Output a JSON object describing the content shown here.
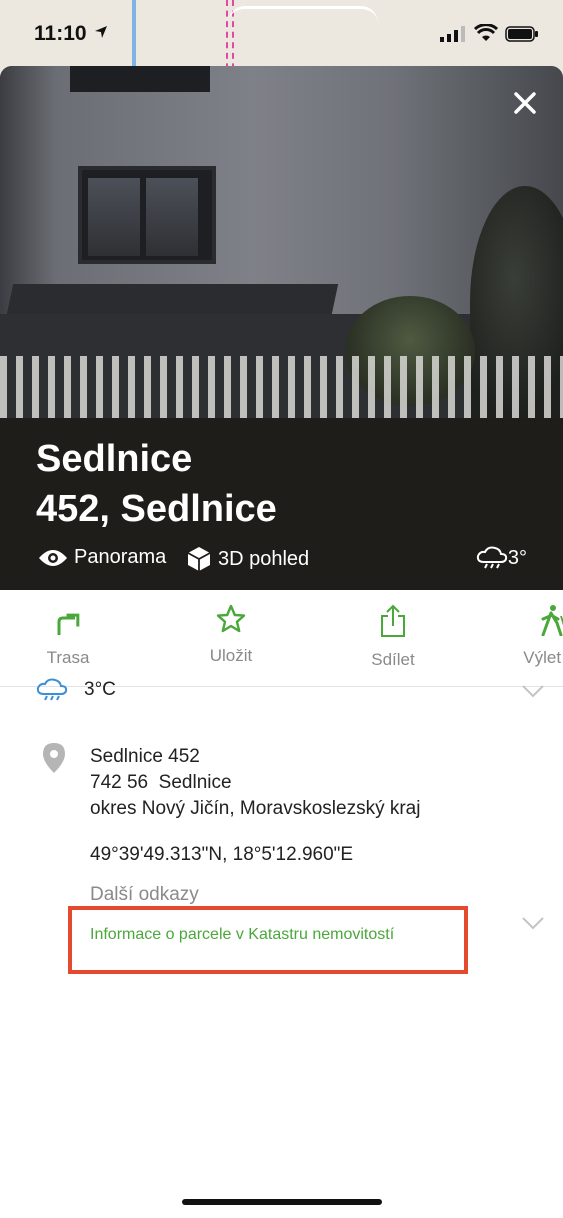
{
  "status_bar": {
    "time": "11:10"
  },
  "place": {
    "title_line1": "Sedlnice",
    "title_line2": "452, Sedlnice",
    "panorama_label": "Panorama",
    "view3d_label": "3D pohled",
    "weather_short": "3°"
  },
  "actions": [
    {
      "label": "Trasa",
      "icon": "route-turn-icon"
    },
    {
      "label": "Uložit",
      "icon": "star-icon"
    },
    {
      "label": "Sdílet",
      "icon": "share-icon"
    },
    {
      "label": "Výlet po",
      "icon": "hiker-icon"
    }
  ],
  "details": {
    "weather": "3°C",
    "address_line1": "Sedlnice 452",
    "address_line2": "742 56  Sedlnice",
    "address_line3": "okres Nový Jičín, Moravskoslezský kraj",
    "coordinates": "49°39'49.313\"N, 18°5'12.960\"E",
    "more_links_label": "Další odkazy",
    "cadastre_link": "Informace o parcele v Katastru nemovitostí"
  },
  "colors": {
    "accent_green": "#4aa83a",
    "highlight_red": "#e64a2e",
    "header_bg": "#1e1d19",
    "weather_blue": "#3a8fd8"
  }
}
